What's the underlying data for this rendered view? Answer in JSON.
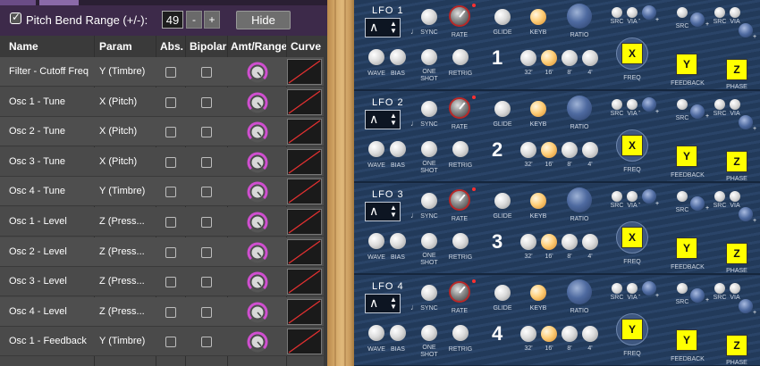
{
  "matrix": {
    "pitch_bend": {
      "enabled": true,
      "label": "Pitch Bend Range (+/-):",
      "value": "49",
      "dec_label": "-",
      "inc_label": "+"
    },
    "hide_label": "Hide",
    "columns": {
      "name": "Name",
      "param": "Param",
      "abs": "Abs.",
      "bipolar": "Bipolar",
      "amt": "Amt/Range",
      "curve": "Curve"
    },
    "rows": [
      {
        "name": "Filter - Cutoff Freq",
        "param": "Y (Timbre)"
      },
      {
        "name": "Osc 1 - Tune",
        "param": "X (Pitch)"
      },
      {
        "name": "Osc 2 - Tune",
        "param": "X (Pitch)"
      },
      {
        "name": "Osc 3 - Tune",
        "param": "X (Pitch)"
      },
      {
        "name": "Osc 4 - Tune",
        "param": "Y (Timbre)"
      },
      {
        "name": "Osc 1 - Level",
        "param": "Z (Press..."
      },
      {
        "name": "Osc 2 - Level",
        "param": "Z (Press..."
      },
      {
        "name": "Osc 3 - Level",
        "param": "Z (Press..."
      },
      {
        "name": "Osc 4 - Level",
        "param": "Z (Press..."
      },
      {
        "name": "Osc 1 - Feedback",
        "param": "Y (Timbre)"
      }
    ]
  },
  "lfo_labels": {
    "sync": "SYNC",
    "rate": "RATE",
    "wave": "WAVE",
    "bias": "BIAS",
    "one": "ONE",
    "shot": "SHOT",
    "retrig": "RETRIG",
    "glide": "GLIDE",
    "keyb": "KEYB",
    "ratio": "RATIO",
    "freq": "FREQ",
    "feedback": "FEEDBACK",
    "phase": "PHASE",
    "src": "SRC",
    "via": "VIA",
    "f32": "32'",
    "f16": "16'",
    "f8": "8'",
    "f4": "4'",
    "plus": "+",
    "minus": "-"
  },
  "lfos": [
    {
      "title": "LFO 1",
      "number": "1",
      "freq_axis": "X",
      "feedback_axis": "Y",
      "phase_axis": "Z"
    },
    {
      "title": "LFO 2",
      "number": "2",
      "freq_axis": "X",
      "feedback_axis": "Y",
      "phase_axis": "Z"
    },
    {
      "title": "LFO 3",
      "number": "3",
      "freq_axis": "X",
      "feedback_axis": "Y",
      "phase_axis": "Z"
    },
    {
      "title": "LFO 4",
      "number": "4",
      "freq_axis": "Y",
      "feedback_axis": "Y",
      "phase_axis": "Z"
    }
  ],
  "icons": {
    "wave": "triangle-wave-icon",
    "updown": "up-down-arrows-icon",
    "note": "note-icon"
  },
  "colors": {
    "header_purple": "#3d2a4a",
    "knob_ring": "#d04fd0",
    "curve_line": "#e23030",
    "axis_button": "#ffff00",
    "led": "#ffcf7a"
  }
}
